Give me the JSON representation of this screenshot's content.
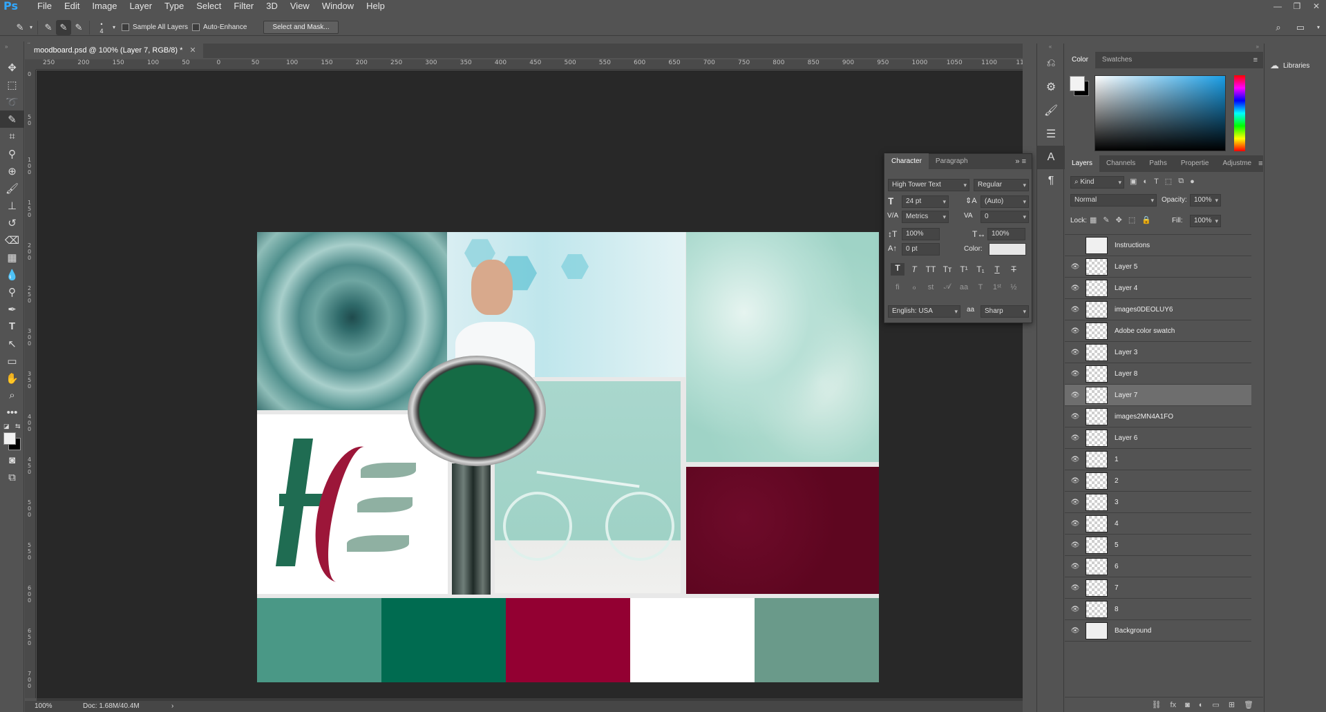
{
  "app": {
    "logo": "Ps"
  },
  "menu": [
    "File",
    "Edit",
    "Image",
    "Layer",
    "Type",
    "Select",
    "Filter",
    "3D",
    "View",
    "Window",
    "Help"
  ],
  "options": {
    "brush_size": "4",
    "sample_all_layers": "Sample All Layers",
    "auto_enhance": "Auto-Enhance",
    "select_and_mask": "Select and Mask..."
  },
  "document": {
    "tab_title": "moodboard.psd @ 100% (Layer 7, RGB/8) *",
    "zoom": "100%",
    "doc_size": "Doc: 1.68M/40.4M"
  },
  "ruler_h": [
    "250",
    "200",
    "150",
    "100",
    "50",
    "0",
    "50",
    "100",
    "150",
    "200",
    "250",
    "300",
    "350",
    "400",
    "450",
    "500",
    "550",
    "600",
    "650",
    "700",
    "750",
    "800",
    "850",
    "900",
    "950",
    "1000",
    "1050",
    "1100",
    "11"
  ],
  "ruler_v": [
    "0",
    "5 0",
    "1 0 0",
    "1 5 0",
    "2 0 0",
    "2 5 0",
    "3 0 0",
    "3 5 0",
    "4 0 0",
    "4 5 0",
    "5 0 0",
    "5 5 0",
    "6 0 0",
    "6 5 0",
    "7 0 0",
    "7 5 0"
  ],
  "swatches": [
    "#4a9886",
    "#006b50",
    "#930032",
    "#ffffff",
    "#6a9a8a"
  ],
  "color_panel": {
    "tabs": [
      "Color",
      "Swatches"
    ]
  },
  "character_panel": {
    "tabs": [
      "Character",
      "Paragraph"
    ],
    "font_family": "High Tower Text",
    "font_style": "Regular",
    "font_size": "24 pt",
    "leading": "(Auto)",
    "kerning": "Metrics",
    "tracking": "0",
    "vertical_scale": "100%",
    "horizontal_scale": "100%",
    "baseline_shift": "0 pt",
    "color_label": "Color:",
    "language": "English: USA",
    "antialias": "Sharp",
    "aa_label": "aa"
  },
  "layers_panel": {
    "tabs": [
      "Layers",
      "Channels",
      "Paths",
      "Propertie",
      "Adjustme"
    ],
    "kind": "Kind",
    "blend_mode": "Normal",
    "opacity_label": "Opacity:",
    "opacity": "100%",
    "lock_label": "Lock:",
    "fill_label": "Fill:",
    "fill": "100%",
    "layers": [
      {
        "name": "Instructions",
        "visible": false
      },
      {
        "name": "Layer 5",
        "visible": true
      },
      {
        "name": "Layer 4",
        "visible": true
      },
      {
        "name": "images0DEOLUY6",
        "visible": true
      },
      {
        "name": "Adobe color swatch",
        "visible": true
      },
      {
        "name": "Layer 3",
        "visible": true
      },
      {
        "name": "Layer 8",
        "visible": true
      },
      {
        "name": "Layer 7",
        "visible": true,
        "selected": true
      },
      {
        "name": "images2MN4A1FO",
        "visible": true
      },
      {
        "name": "Layer 6",
        "visible": true
      },
      {
        "name": "1",
        "visible": true
      },
      {
        "name": "2",
        "visible": true
      },
      {
        "name": "3",
        "visible": true
      },
      {
        "name": "4",
        "visible": true
      },
      {
        "name": "5",
        "visible": true
      },
      {
        "name": "6",
        "visible": true
      },
      {
        "name": "7",
        "visible": true
      },
      {
        "name": "8",
        "visible": true
      },
      {
        "name": "Background",
        "visible": true
      }
    ]
  },
  "libraries": {
    "label": "Libraries"
  }
}
